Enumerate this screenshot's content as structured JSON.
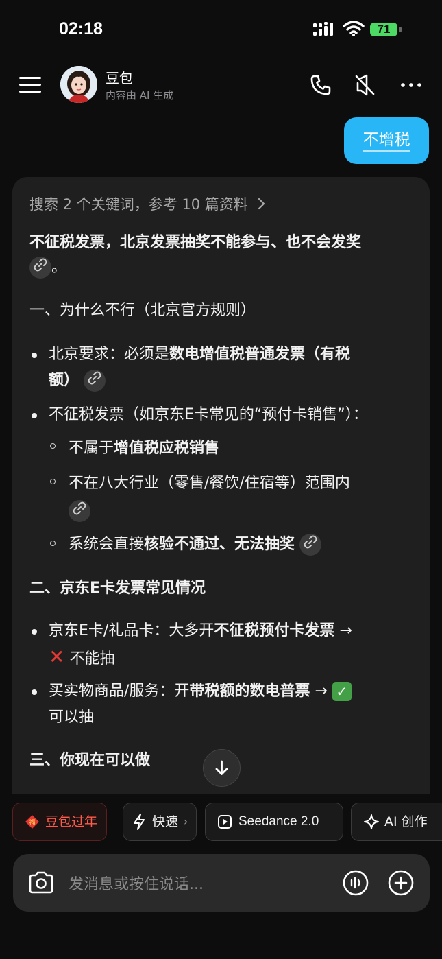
{
  "status_bar": {
    "time": "02:18",
    "battery": "71"
  },
  "header": {
    "name": "豆包",
    "subtitle": "内容由 AI 生成"
  },
  "user_message": "不增税",
  "answer": {
    "search_summary": "搜索 2 个关键词，参考 10 篇资料",
    "summary_line1": "不征税发票，北京发票抽奖不能参与、也不会发奖",
    "summary_line1_end": "。",
    "section1": "一、为什么不行（北京官方规则）",
    "b1_prefix": "北京要求：必须是",
    "b1_bold": "数电增值税普通发票（有税",
    "b1_bold2": "额）",
    "b2": "不征税发票（如京东E卡常见的“预付卡销售”）：",
    "s1_prefix": "不属于",
    "s1_bold": "增值税应税销售",
    "s2": "不在八大行业（零售/餐饮/住宿等）范围内",
    "s3_prefix": "系统会直接",
    "s3_bold": "核验不通过、无法抽奖",
    "section2": "二、京东E卡发票常见情况",
    "b3_prefix": "京东E卡/礼品卡：大多开",
    "b3_bold": "不征税预付卡发票",
    "b3_arrow": " →",
    "b3_line2": " 不能抽",
    "b4_prefix": "买实物商品/服务：开",
    "b4_bold": "带税额的数电普票",
    "b4_arrow": " →",
    "b4_line2": "可以抽",
    "section3": "三、你现在可以做"
  },
  "quick_actions": [
    {
      "label": "豆包过年"
    },
    {
      "label": "快速"
    },
    {
      "label": "Seedance 2.0"
    },
    {
      "label": "AI 创作"
    }
  ],
  "input": {
    "placeholder": "发消息或按住说话..."
  },
  "colors": {
    "accent": "#29b6f6",
    "festival": "#ff5a4a",
    "background": "#0d0d0d",
    "card": "#1f1f1f"
  }
}
